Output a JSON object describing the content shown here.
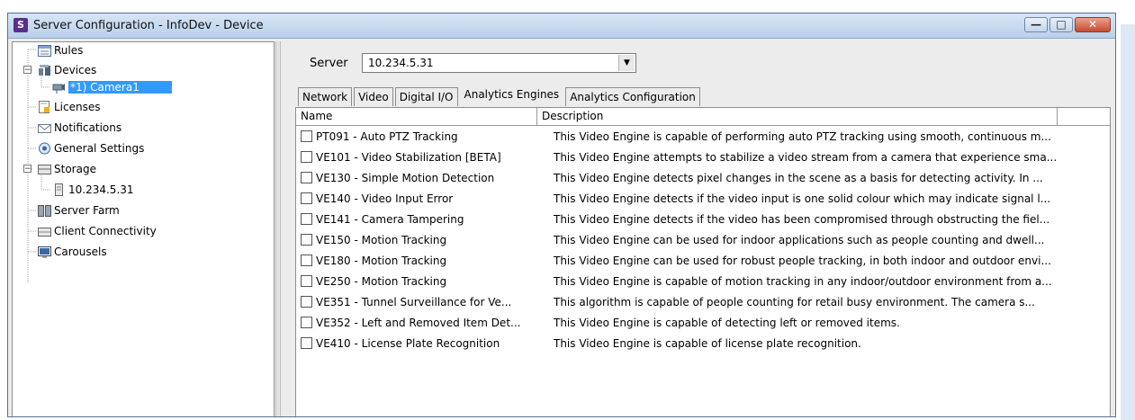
{
  "window": {
    "title": "Server Configuration - InfoDev - Device",
    "app_icon_letter": "S",
    "buttons": {
      "minimize": "—",
      "maximize": "□",
      "close": "✕"
    }
  },
  "tree": {
    "items": [
      {
        "label": "Rules",
        "icon": "rules-icon"
      },
      {
        "label": "Devices",
        "icon": "devices-icon"
      },
      {
        "label": "*1) Camera1",
        "icon": "camera-icon"
      },
      {
        "label": "Licenses",
        "icon": "licenses-icon"
      },
      {
        "label": "Notifications",
        "icon": "notifications-icon"
      },
      {
        "label": "General Settings",
        "icon": "general-settings-icon"
      },
      {
        "label": "Storage",
        "icon": "storage-icon"
      },
      {
        "label": "10.234.5.31",
        "icon": "storage-server-icon"
      },
      {
        "label": "Server Farm",
        "icon": "server-farm-icon"
      },
      {
        "label": "Client Connectivity",
        "icon": "client-connectivity-icon"
      },
      {
        "label": "Carousels",
        "icon": "carousels-icon"
      }
    ]
  },
  "server": {
    "label": "Server",
    "value": "10.234.5.31"
  },
  "tabs": [
    {
      "label": "Network"
    },
    {
      "label": "Video"
    },
    {
      "label": "Digital I/O"
    },
    {
      "label": "Analytics Engines"
    },
    {
      "label": "Analytics Configuration"
    }
  ],
  "table": {
    "columns": [
      "Name",
      "Description"
    ],
    "rows": [
      {
        "name": "PT091 - Auto PTZ Tracking",
        "description": "This Video Engine is capable of performing auto PTZ tracking using smooth, continuous m...",
        "checked": false
      },
      {
        "name": "VE101 - Video Stabilization [BETA]",
        "description": "This Video Engine attempts to stabilize a video stream from a camera that experience sma...",
        "checked": false
      },
      {
        "name": "VE130 - Simple Motion Detection",
        "description": "This Video Engine detects pixel changes in the scene as a basis for detecting activity. In ...",
        "checked": false
      },
      {
        "name": "VE140 - Video Input Error",
        "description": "This Video Engine detects if the video input is one solid colour which may indicate signal l...",
        "checked": false
      },
      {
        "name": "VE141 - Camera Tampering",
        "description": "This Video Engine detects if the video has been compromised through obstructing the fiel...",
        "checked": false
      },
      {
        "name": "VE150 - Motion Tracking",
        "description": "This Video Engine can be used for indoor applications such as people counting and dwell...",
        "checked": false
      },
      {
        "name": "VE180 - Motion Tracking",
        "description": "This Video Engine can be used for robust people tracking, in both indoor and outdoor envi...",
        "checked": false
      },
      {
        "name": "VE250 - Motion Tracking",
        "description": "This Video Engine is capable of motion tracking in any indoor/outdoor environment from a...",
        "checked": false
      },
      {
        "name": "VE351 - Tunnel Surveillance for Ve...",
        "description": "This algorithm is capable of people counting for retail busy environment.   The camera s...",
        "checked": false
      },
      {
        "name": "VE352 - Left and Removed Item Det...",
        "description": "This Video Engine is capable of detecting left or removed items.",
        "checked": false
      },
      {
        "name": "VE410 - License Plate Recognition",
        "description": "This Video Engine is capable of license plate recognition.",
        "checked": false
      }
    ]
  }
}
